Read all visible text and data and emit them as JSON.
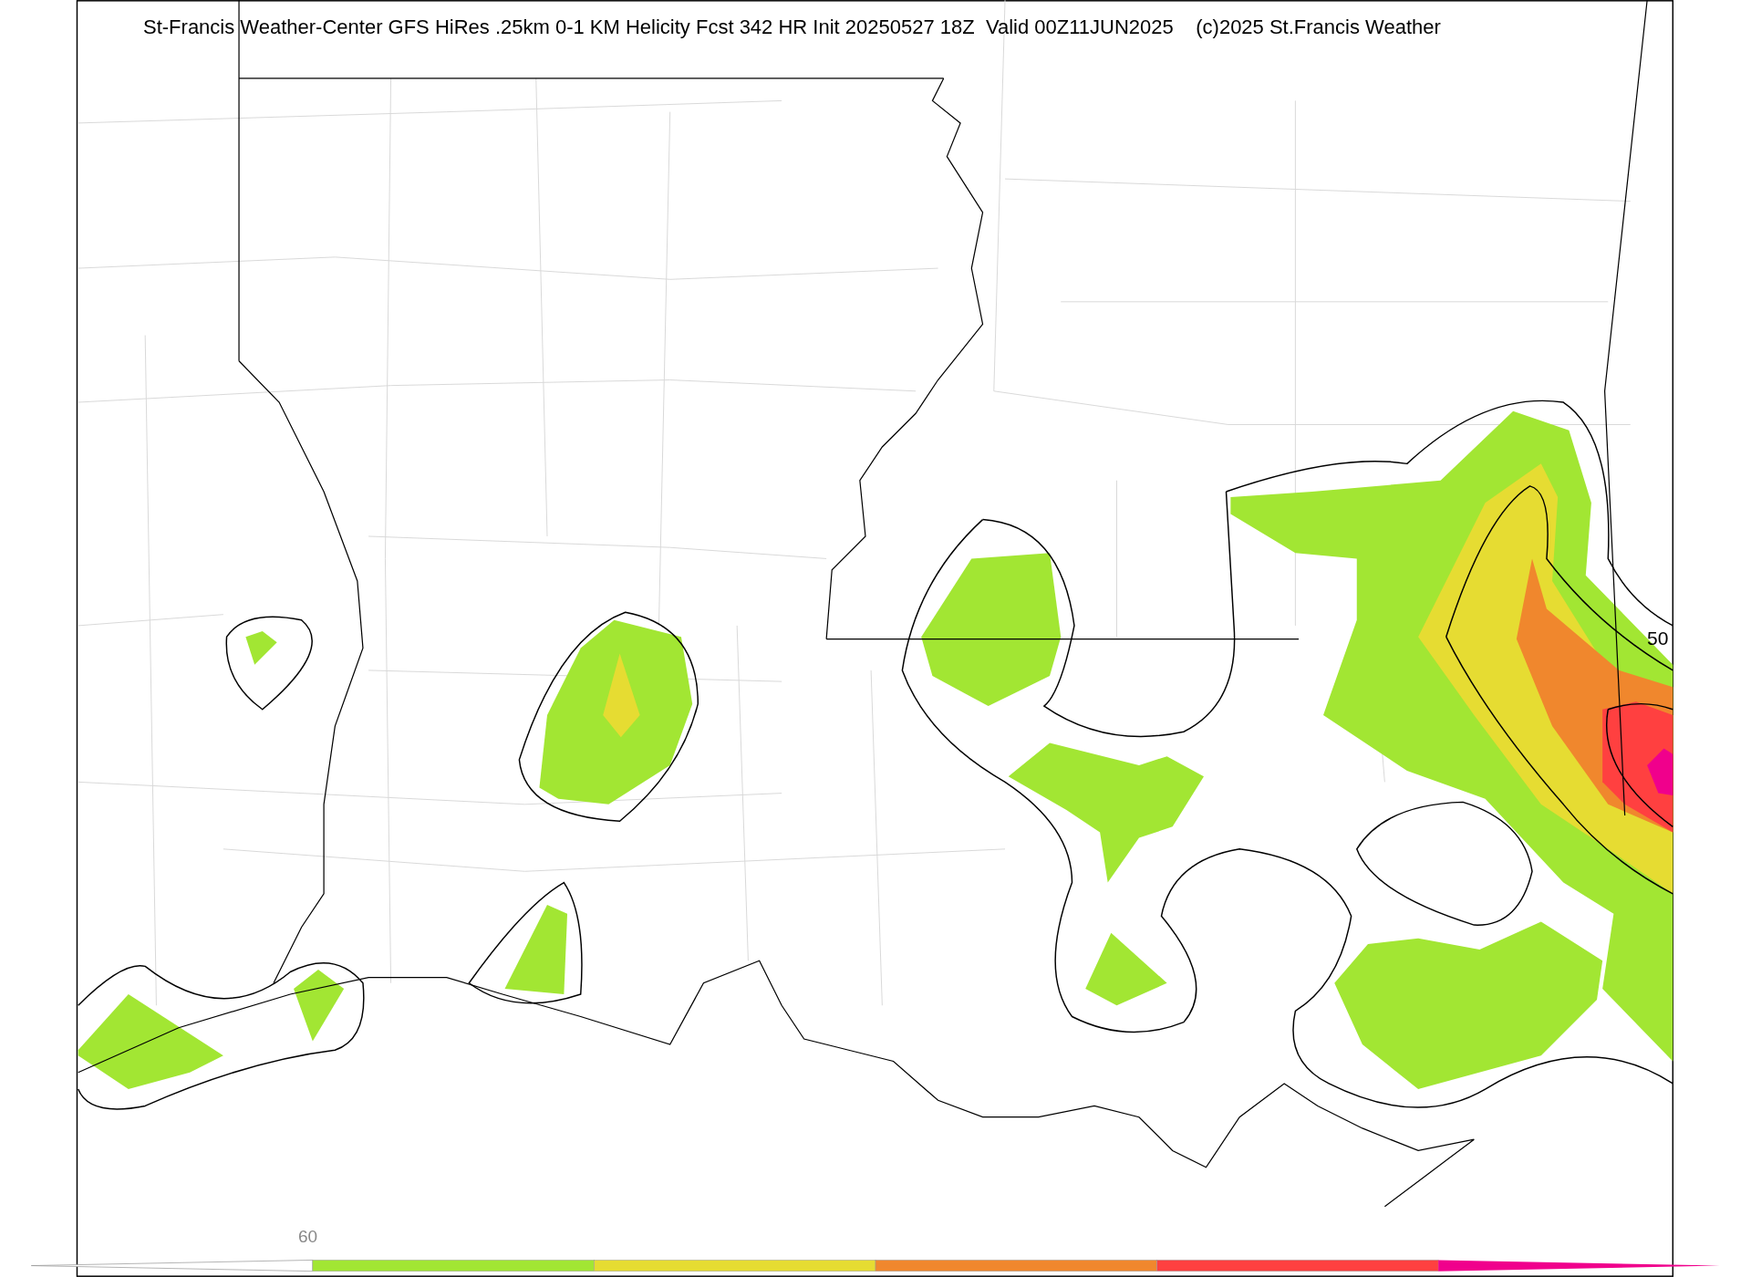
{
  "title": "St-Francis Weather-Center GFS HiRes .25km 0-1 KM Helicity Fcst 342 HR Init 20250527 18Z  Valid 00Z11JUN2025    (c)2025 St.Francis Weather",
  "contour_label": "50",
  "colorbar": {
    "label": "60",
    "segments": [
      {
        "kind": "extend",
        "color": "#ffffff"
      },
      {
        "kind": "box",
        "color": "#a2e633"
      },
      {
        "kind": "box",
        "color": "#e6dc32"
      },
      {
        "kind": "box",
        "color": "#f0872d"
      },
      {
        "kind": "box",
        "color": "#ff4040"
      },
      {
        "kind": "extend",
        "color": "#f0008c"
      }
    ]
  }
}
